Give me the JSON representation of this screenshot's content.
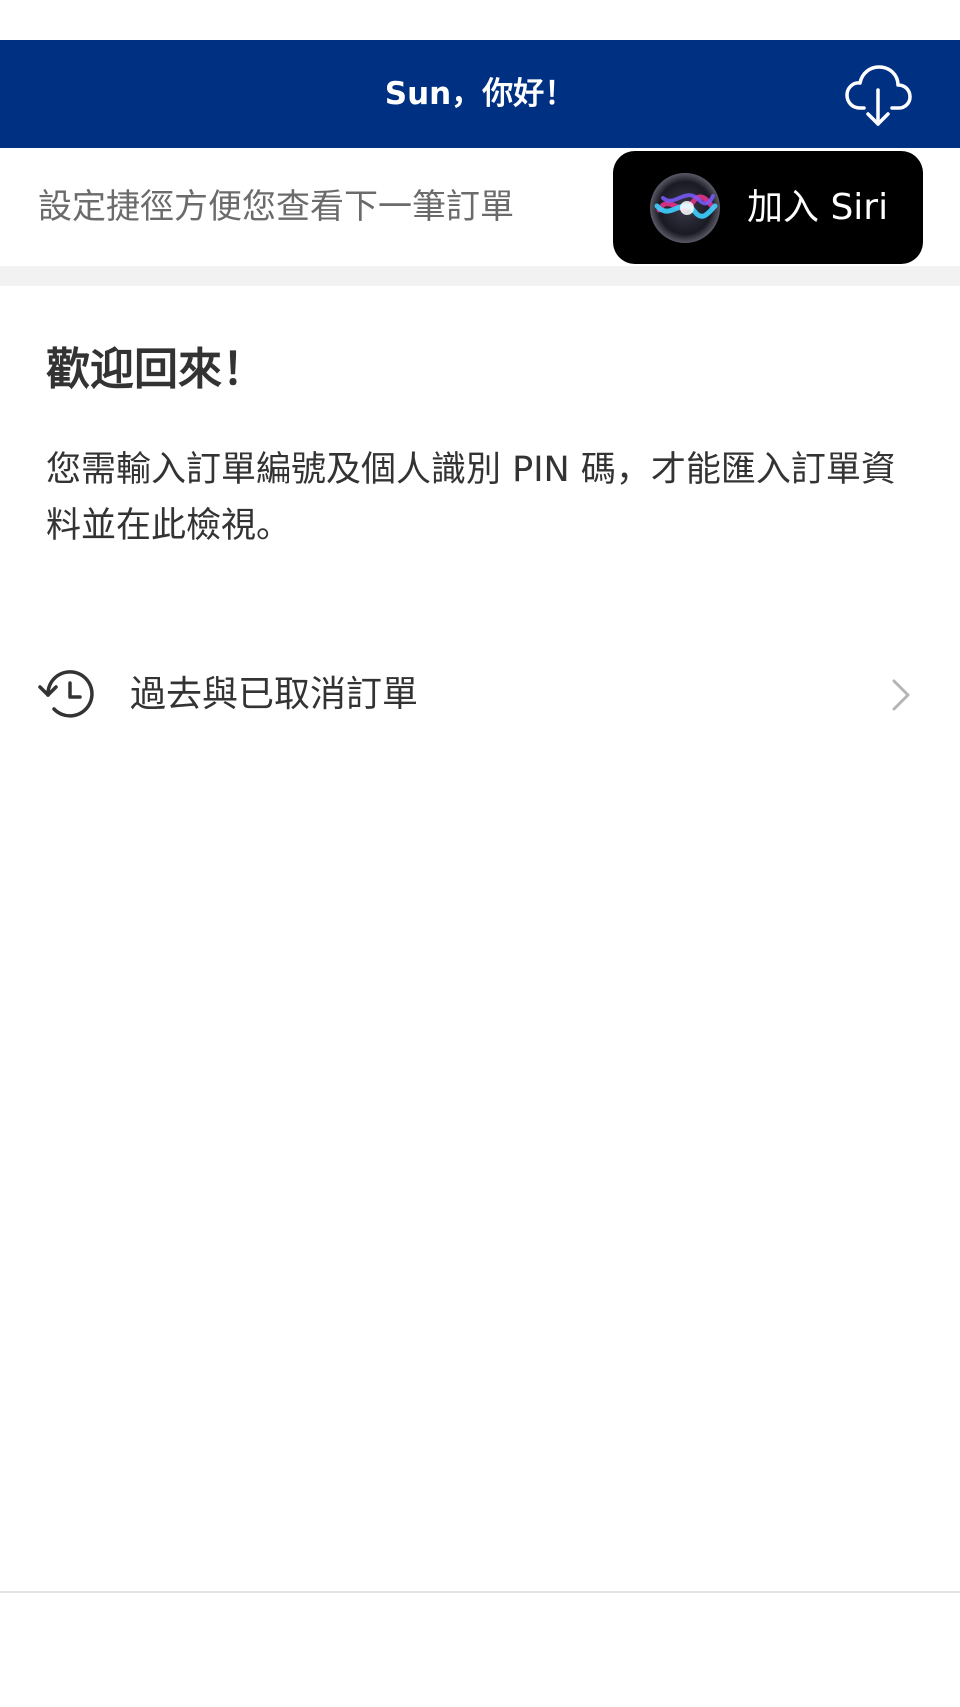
{
  "header": {
    "title": "Sun，你好！",
    "icons": {
      "download": "cloud-download-icon"
    },
    "background_color": "#003082"
  },
  "siri": {
    "prompt": "設定捷徑方便您查看下一筆訂單",
    "button_label": "加入 Siri",
    "icon": "siri-orb-icon"
  },
  "welcome": {
    "title": "歡迎回來！",
    "body": "您需輸入訂單編號及個人識別 PIN 碼，才能匯入訂單資料並在此檢視。"
  },
  "history": {
    "label": "過去與已取消訂單",
    "icon": "history-clock-icon",
    "chevron": "chevron-right-icon"
  }
}
